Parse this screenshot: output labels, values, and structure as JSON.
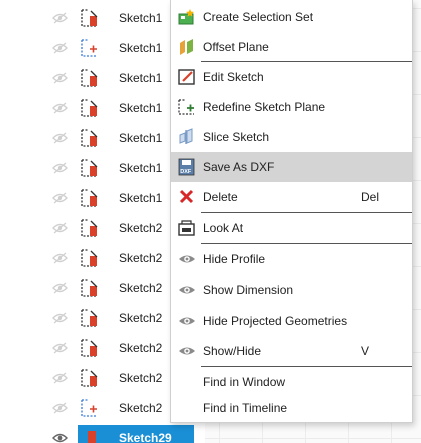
{
  "tree": {
    "rows": [
      {
        "label": "Sketch1",
        "variant": "std"
      },
      {
        "label": "Sketch1",
        "variant": "alt"
      },
      {
        "label": "Sketch1",
        "variant": "std"
      },
      {
        "label": "Sketch1",
        "variant": "std"
      },
      {
        "label": "Sketch1",
        "variant": "std"
      },
      {
        "label": "Sketch1",
        "variant": "std"
      },
      {
        "label": "Sketch1",
        "variant": "std"
      },
      {
        "label": "Sketch2",
        "variant": "std"
      },
      {
        "label": "Sketch2",
        "variant": "std"
      },
      {
        "label": "Sketch2",
        "variant": "std"
      },
      {
        "label": "Sketch2",
        "variant": "std"
      },
      {
        "label": "Sketch2",
        "variant": "std"
      },
      {
        "label": "Sketch2",
        "variant": "std"
      },
      {
        "label": "Sketch2",
        "variant": "alt"
      }
    ],
    "selected_row": {
      "label": "Sketch29"
    }
  },
  "menu": {
    "items": [
      {
        "label": "Create Selection Set",
        "icon": "create-selection-set-icon",
        "shortcut": ""
      },
      {
        "label": "Offset Plane",
        "icon": "offset-plane-icon",
        "shortcut": ""
      },
      {
        "label": "Edit Sketch",
        "icon": "edit-sketch-icon",
        "shortcut": ""
      },
      {
        "label": "Redefine Sketch Plane",
        "icon": "redefine-sketch-plane-icon",
        "shortcut": ""
      },
      {
        "label": "Slice Sketch",
        "icon": "slice-sketch-icon",
        "shortcut": ""
      },
      {
        "label": "Save As DXF",
        "icon": "save-as-dxf-icon",
        "shortcut": "",
        "highlighted": true
      },
      {
        "label": "Delete",
        "icon": "delete-icon",
        "shortcut": "Del"
      },
      {
        "label": "Look At",
        "icon": "look-at-icon",
        "shortcut": ""
      },
      {
        "label": "Hide Profile",
        "icon": "eye-icon",
        "shortcut": ""
      },
      {
        "label": "Show Dimension",
        "icon": "eye-icon",
        "shortcut": ""
      },
      {
        "label": "Hide Projected Geometries",
        "icon": "eye-icon",
        "shortcut": ""
      },
      {
        "label": "Show/Hide",
        "icon": "eye-icon",
        "shortcut": "V"
      },
      {
        "label": "Find in Window",
        "icon": "",
        "shortcut": ""
      },
      {
        "label": "Find in Timeline",
        "icon": "",
        "shortcut": ""
      }
    ]
  },
  "colors": {
    "selection": "#1a8fd6",
    "menu_highlight": "#d4d4d4",
    "sketch_red": "#d9412b",
    "delete_red": "#d62828"
  }
}
